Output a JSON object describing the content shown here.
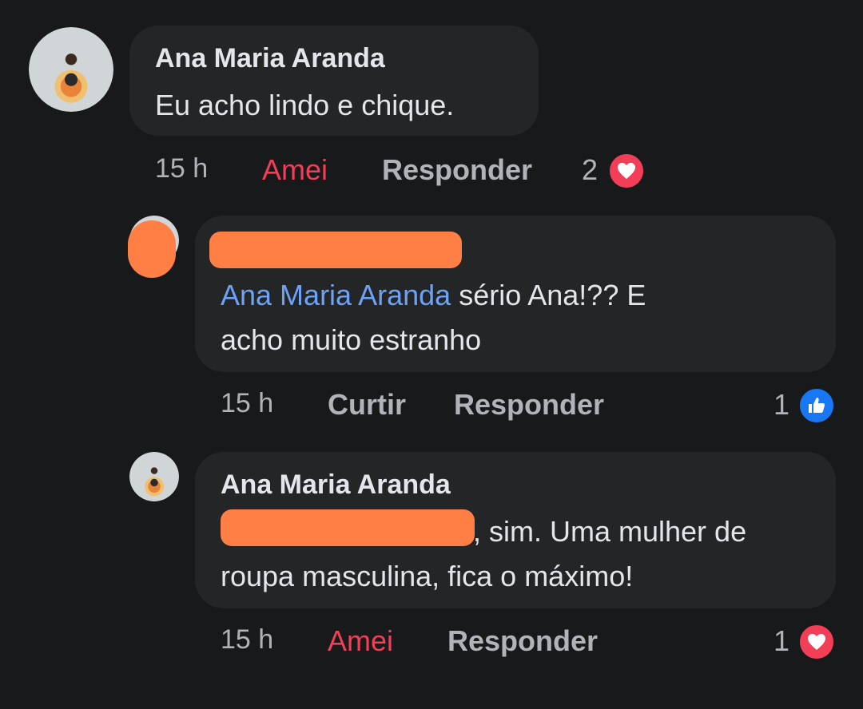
{
  "comments": [
    {
      "author": "Ana Maria Aranda",
      "text": "Eu acho lindo e chique.",
      "time": "15 h",
      "reaction_action": "Amei",
      "reply_action": "Responder",
      "reaction_count": "2",
      "reaction_type": "heart-icon",
      "accent": "#f33e58"
    },
    {
      "mention": "Ana Maria Aranda",
      "text_line1": " sério Ana!?? E",
      "text_line2": "acho muito estranho",
      "time": "15 h",
      "reaction_action": "Curtir",
      "reply_action": "Responder",
      "reaction_count": "1",
      "reaction_type": "like-icon",
      "accent": "#1877f2"
    },
    {
      "author": "Ana Maria Aranda",
      "text_line1": ", sim. Uma mulher de",
      "text_line2": "roupa masculina, fica o máximo!",
      "time": "15 h",
      "reaction_action": "Amei",
      "reply_action": "Responder",
      "reaction_count": "1",
      "reaction_type": "heart-icon",
      "accent": "#f33e58"
    }
  ]
}
